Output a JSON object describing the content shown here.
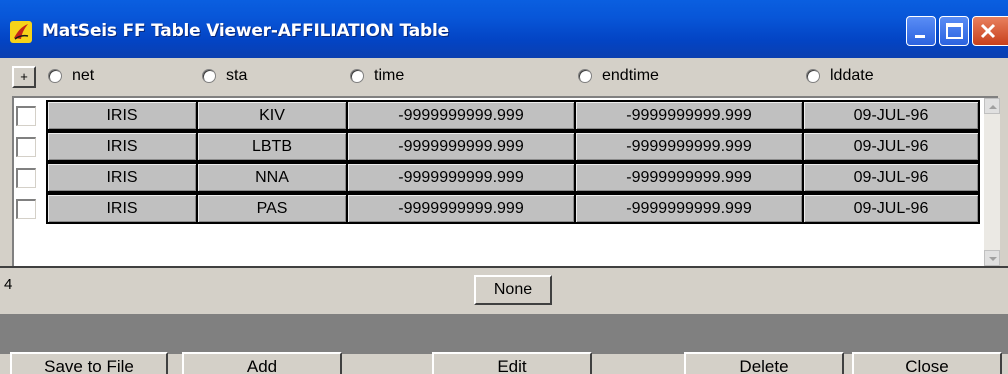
{
  "window": {
    "title": "MatSeis FF Table Viewer-AFFILIATION Table",
    "icon": "java-app-icon",
    "controls": [
      "minimize-icon",
      "maximize-icon",
      "close-icon"
    ]
  },
  "header": {
    "expand_label": "+",
    "columns": [
      "net",
      "sta",
      "time",
      "endtime",
      "lddate"
    ]
  },
  "table": {
    "rows": [
      [
        "IRIS",
        "KIV",
        "-9999999999.999",
        "-9999999999.999",
        "09-JUL-96"
      ],
      [
        "IRIS",
        "LBTB",
        "-9999999999.999",
        "-9999999999.999",
        "09-JUL-96"
      ],
      [
        "IRIS",
        "NNA",
        "-9999999999.999",
        "-9999999999.999",
        "09-JUL-96"
      ],
      [
        "IRIS",
        "PAS",
        "-9999999999.999",
        "-9999999999.999",
        "09-JUL-96"
      ]
    ]
  },
  "footer": {
    "row_count": "4",
    "none_label": "None"
  },
  "actions": {
    "save": "Save to File",
    "add": "Add",
    "edit": "Edit",
    "delete": "Delete",
    "close": "Close"
  },
  "colors": {
    "titlebar": "#0a5fe0",
    "face": "#d4d0c8",
    "cell": "#c0c0c0",
    "band": "#808080"
  }
}
